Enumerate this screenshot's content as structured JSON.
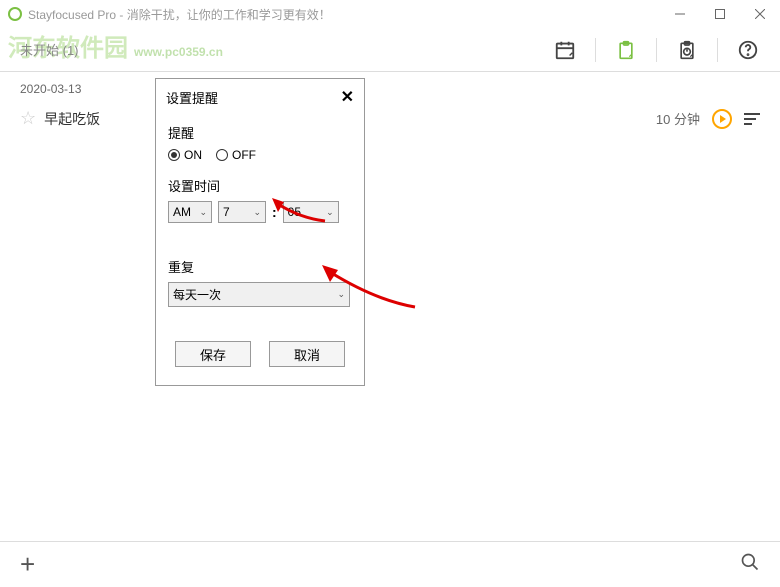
{
  "titlebar": {
    "text": "Stayfocused Pro - 消除干扰，让你的工作和学习更有效！"
  },
  "watermark": {
    "main": "河东软件园",
    "sub": "www.pc0359.cn"
  },
  "toolbar": {
    "left_text": "未开始 (1)"
  },
  "content": {
    "date": "2020-03-13",
    "task_name": "早起吃饭",
    "duration": "10 分钟"
  },
  "dialog": {
    "title": "设置提醒",
    "reminder_label": "提醒",
    "on_label": "ON",
    "off_label": "OFF",
    "time_label": "设置时间",
    "ampm": "AM",
    "hour": "7",
    "minute": "05",
    "repeat_label": "重复",
    "repeat_value": "每天一次",
    "save": "保存",
    "cancel": "取消"
  }
}
